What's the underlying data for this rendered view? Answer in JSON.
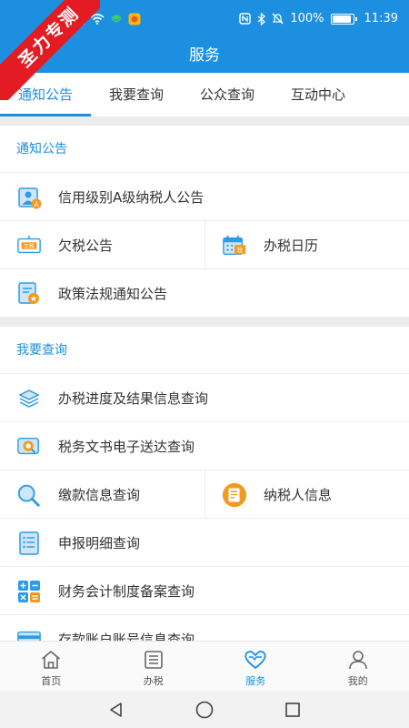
{
  "status_bar": {
    "battery_text": "100%",
    "battery_level": 1.0,
    "time": "11:39"
  },
  "ribbon": {
    "text": "圣力专测"
  },
  "header": {
    "title": "服务"
  },
  "tabs": [
    {
      "label": "通知公告",
      "active": true
    },
    {
      "label": "我要查询",
      "active": false
    },
    {
      "label": "公众查询",
      "active": false
    },
    {
      "label": "互动中心",
      "active": false
    }
  ],
  "sections": {
    "notice": {
      "title": "通知公告",
      "items": {
        "credit": {
          "label": "信用级别A级纳税人公告",
          "icon": "credit-a-icon",
          "icon_text": "A"
        },
        "arrears": {
          "label": "欠税公告",
          "icon": "arrears-icon",
          "icon_text": "欠税"
        },
        "calendar": {
          "label": "办税日历",
          "icon": "tax-calendar-icon",
          "icon_text": "税"
        },
        "policy": {
          "label": "政策法规通知公告",
          "icon": "policy-doc-icon"
        }
      }
    },
    "query": {
      "title": "我要查询",
      "items": {
        "progress": {
          "label": "办税进度及结果信息查询",
          "icon": "layers-icon"
        },
        "documents": {
          "label": "税务文书电子送达查询",
          "icon": "document-search-icon"
        },
        "payment": {
          "label": "缴款信息查询",
          "icon": "magnifier-icon"
        },
        "taxpayer": {
          "label": "纳税人信息",
          "icon": "taxpayer-info-icon"
        },
        "declaration": {
          "label": "申报明细查询",
          "icon": "list-detail-icon"
        },
        "accounting": {
          "label": "财务会计制度备案查询",
          "icon": "calculator-icon"
        },
        "bank": {
          "label": "存款账户账号信息查询",
          "icon": "bank-card-icon"
        }
      }
    }
  },
  "bottom_nav": [
    {
      "label": "首页",
      "icon": "home-icon",
      "active": false
    },
    {
      "label": "办税",
      "icon": "tax-list-icon",
      "active": false
    },
    {
      "label": "服务",
      "icon": "heart-icon",
      "active": true
    },
    {
      "label": "我的",
      "icon": "user-icon",
      "active": false
    }
  ],
  "colors": {
    "primary": "#1c8fe0",
    "ribbon": "#e31b23",
    "icon_orange": "#f39a1e",
    "icon_blue": "#2d9be6"
  }
}
